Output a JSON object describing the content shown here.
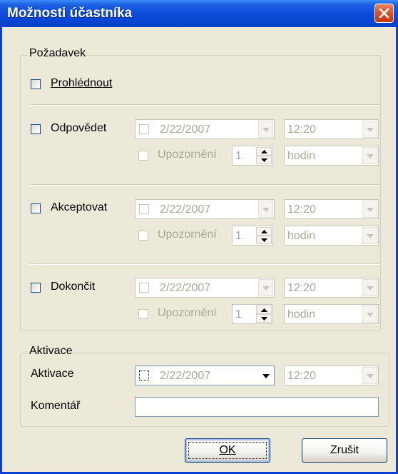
{
  "window": {
    "title": "Možnosti účastníka"
  },
  "request_group": {
    "legend": "Požadavek",
    "review": {
      "label": "Prohlédnout",
      "checked": false
    },
    "rows": [
      {
        "key": "reply",
        "label": "Odpovědet",
        "checked": false,
        "date": "2/22/2007",
        "time": "12:20",
        "reminder": {
          "label": "Upozornění",
          "value": "1",
          "unit": "hodin"
        }
      },
      {
        "key": "accept",
        "label": "Akceptovat",
        "checked": false,
        "date": "2/22/2007",
        "time": "12:20",
        "reminder": {
          "label": "Upozornění",
          "value": "1",
          "unit": "hodin"
        }
      },
      {
        "key": "complete",
        "label": "Dokončit",
        "checked": false,
        "date": "2/22/2007",
        "time": "12:20",
        "reminder": {
          "label": "Upozornění",
          "value": "1",
          "unit": "hodin"
        }
      }
    ]
  },
  "activation_group": {
    "legend": "Aktivace",
    "activation": {
      "label": "Aktivace",
      "date": "2/22/2007",
      "time": "12:20"
    },
    "comment": {
      "label": "Komentář",
      "value": ""
    }
  },
  "buttons": {
    "ok": "OK",
    "cancel": "Zrušit"
  },
  "colors": {
    "titlebar": "#0a49d8",
    "dialog_bg": "#ece9d8",
    "disabled_text": "#aca899",
    "close_button": "#d84c21"
  }
}
